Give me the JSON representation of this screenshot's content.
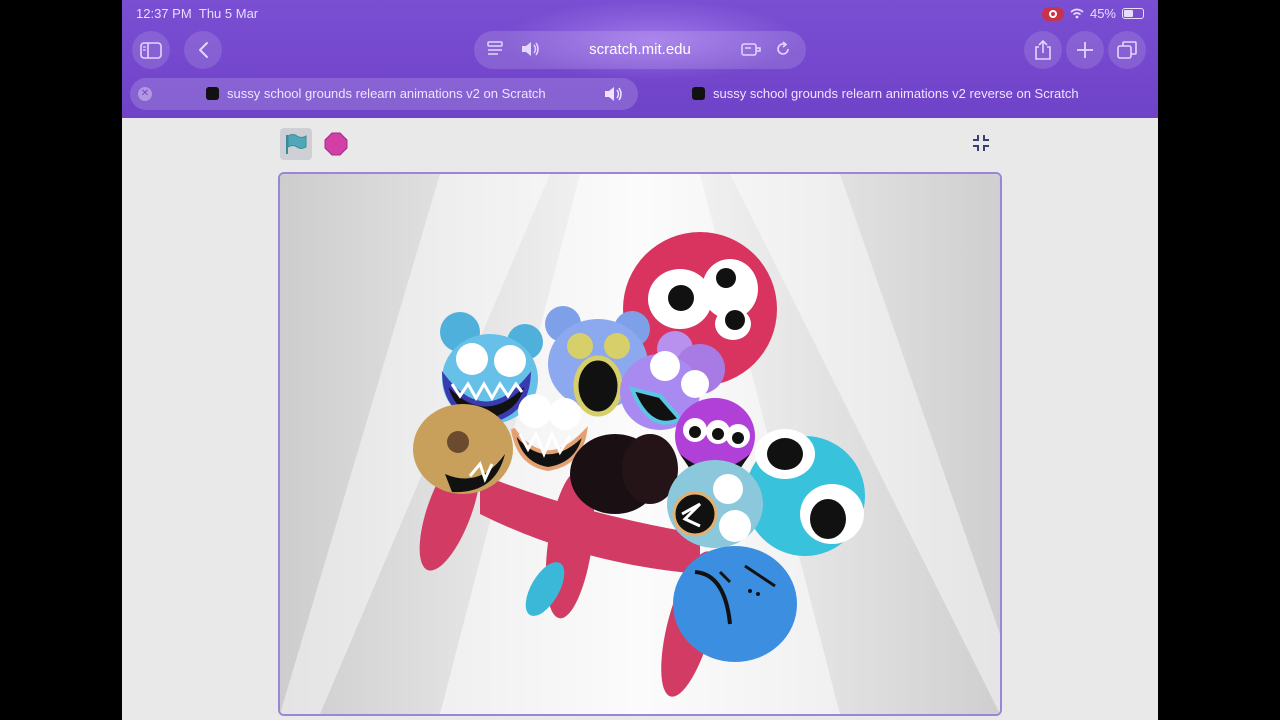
{
  "status_bar": {
    "time": "12:37 PM",
    "date": "Thu 5 Mar",
    "battery": "45%",
    "icons": [
      "screen-record-icon",
      "wifi-icon",
      "battery-icon"
    ]
  },
  "toolbar": {
    "url": "scratch.mit.edu",
    "left_icons": [
      "sidebar-icon",
      "back-chevron-icon"
    ],
    "url_icons": [
      "reader-icon",
      "speaker-icon",
      "extension-icon",
      "reload-icon"
    ],
    "right_icons": [
      "share-icon",
      "plus-icon",
      "tabs-icon"
    ]
  },
  "tabs": [
    {
      "title": "sussy school grounds relearn animations v2 on Scratch",
      "active": true,
      "playing_audio": true
    },
    {
      "title": "sussy school grounds relearn animations v2 reverse on Scratch",
      "active": false,
      "playing_audio": false
    }
  ],
  "player": {
    "green_flag_icon": "green-flag-icon",
    "stop_icon": "stop-sign-icon",
    "fullscreen_icon": "exit-fullscreen-icon",
    "colors": {
      "accent": "#7447cc",
      "stage_border": "#9a86d4",
      "stop": "#d23fa5",
      "flag": "#4fa8b8"
    }
  }
}
